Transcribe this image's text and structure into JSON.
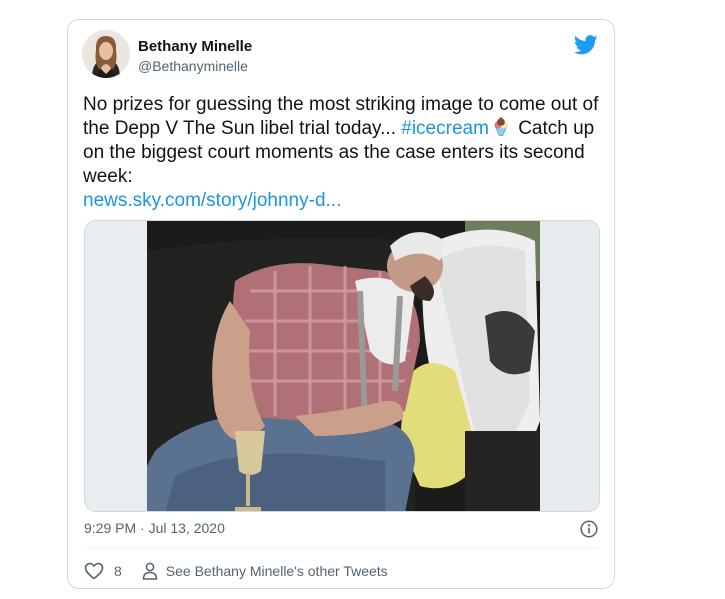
{
  "tweet": {
    "author_name": "Bethany Minelle",
    "author_handle": "@Bethanyminelle",
    "text_main": "No prizes for guessing the most striking image to come out of the Depp V The Sun libel trial today... ",
    "hashtag": "#icecream",
    "text_after": " Catch up on the biggest court moments as the case enters its second week:",
    "link": "news.sky.com/story/johnny-d...",
    "timestamp": "9:29 PM · Jul 13, 2020",
    "like_count": "8",
    "other_tweets_label": "See Bethany Minelle's other Tweets",
    "brand_color": "#1d9bf0",
    "link_color": "#1b95e0"
  }
}
